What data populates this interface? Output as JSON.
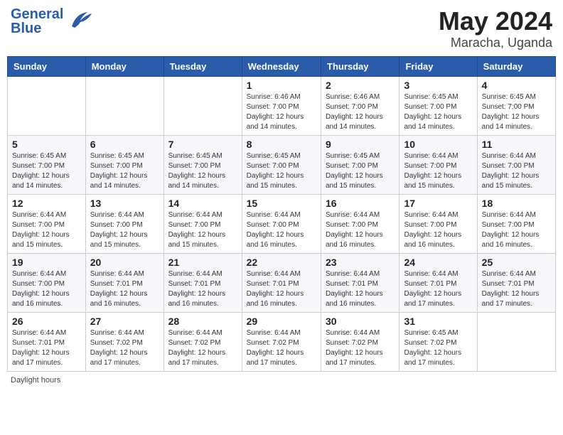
{
  "header": {
    "logo_general": "General",
    "logo_blue": "Blue",
    "month_year": "May 2024",
    "location": "Maracha, Uganda"
  },
  "footer": {
    "note": "Daylight hours"
  },
  "days_of_week": [
    "Sunday",
    "Monday",
    "Tuesday",
    "Wednesday",
    "Thursday",
    "Friday",
    "Saturday"
  ],
  "weeks": [
    [
      {
        "day": "",
        "info": ""
      },
      {
        "day": "",
        "info": ""
      },
      {
        "day": "",
        "info": ""
      },
      {
        "day": "1",
        "info": "Sunrise: 6:46 AM\nSunset: 7:00 PM\nDaylight: 12 hours and 14 minutes."
      },
      {
        "day": "2",
        "info": "Sunrise: 6:46 AM\nSunset: 7:00 PM\nDaylight: 12 hours and 14 minutes."
      },
      {
        "day": "3",
        "info": "Sunrise: 6:45 AM\nSunset: 7:00 PM\nDaylight: 12 hours and 14 minutes."
      },
      {
        "day": "4",
        "info": "Sunrise: 6:45 AM\nSunset: 7:00 PM\nDaylight: 12 hours and 14 minutes."
      }
    ],
    [
      {
        "day": "5",
        "info": "Sunrise: 6:45 AM\nSunset: 7:00 PM\nDaylight: 12 hours and 14 minutes."
      },
      {
        "day": "6",
        "info": "Sunrise: 6:45 AM\nSunset: 7:00 PM\nDaylight: 12 hours and 14 minutes."
      },
      {
        "day": "7",
        "info": "Sunrise: 6:45 AM\nSunset: 7:00 PM\nDaylight: 12 hours and 14 minutes."
      },
      {
        "day": "8",
        "info": "Sunrise: 6:45 AM\nSunset: 7:00 PM\nDaylight: 12 hours and 15 minutes."
      },
      {
        "day": "9",
        "info": "Sunrise: 6:45 AM\nSunset: 7:00 PM\nDaylight: 12 hours and 15 minutes."
      },
      {
        "day": "10",
        "info": "Sunrise: 6:44 AM\nSunset: 7:00 PM\nDaylight: 12 hours and 15 minutes."
      },
      {
        "day": "11",
        "info": "Sunrise: 6:44 AM\nSunset: 7:00 PM\nDaylight: 12 hours and 15 minutes."
      }
    ],
    [
      {
        "day": "12",
        "info": "Sunrise: 6:44 AM\nSunset: 7:00 PM\nDaylight: 12 hours and 15 minutes."
      },
      {
        "day": "13",
        "info": "Sunrise: 6:44 AM\nSunset: 7:00 PM\nDaylight: 12 hours and 15 minutes."
      },
      {
        "day": "14",
        "info": "Sunrise: 6:44 AM\nSunset: 7:00 PM\nDaylight: 12 hours and 15 minutes."
      },
      {
        "day": "15",
        "info": "Sunrise: 6:44 AM\nSunset: 7:00 PM\nDaylight: 12 hours and 16 minutes."
      },
      {
        "day": "16",
        "info": "Sunrise: 6:44 AM\nSunset: 7:00 PM\nDaylight: 12 hours and 16 minutes."
      },
      {
        "day": "17",
        "info": "Sunrise: 6:44 AM\nSunset: 7:00 PM\nDaylight: 12 hours and 16 minutes."
      },
      {
        "day": "18",
        "info": "Sunrise: 6:44 AM\nSunset: 7:00 PM\nDaylight: 12 hours and 16 minutes."
      }
    ],
    [
      {
        "day": "19",
        "info": "Sunrise: 6:44 AM\nSunset: 7:00 PM\nDaylight: 12 hours and 16 minutes."
      },
      {
        "day": "20",
        "info": "Sunrise: 6:44 AM\nSunset: 7:01 PM\nDaylight: 12 hours and 16 minutes."
      },
      {
        "day": "21",
        "info": "Sunrise: 6:44 AM\nSunset: 7:01 PM\nDaylight: 12 hours and 16 minutes."
      },
      {
        "day": "22",
        "info": "Sunrise: 6:44 AM\nSunset: 7:01 PM\nDaylight: 12 hours and 16 minutes."
      },
      {
        "day": "23",
        "info": "Sunrise: 6:44 AM\nSunset: 7:01 PM\nDaylight: 12 hours and 16 minutes."
      },
      {
        "day": "24",
        "info": "Sunrise: 6:44 AM\nSunset: 7:01 PM\nDaylight: 12 hours and 17 minutes."
      },
      {
        "day": "25",
        "info": "Sunrise: 6:44 AM\nSunset: 7:01 PM\nDaylight: 12 hours and 17 minutes."
      }
    ],
    [
      {
        "day": "26",
        "info": "Sunrise: 6:44 AM\nSunset: 7:01 PM\nDaylight: 12 hours and 17 minutes."
      },
      {
        "day": "27",
        "info": "Sunrise: 6:44 AM\nSunset: 7:02 PM\nDaylight: 12 hours and 17 minutes."
      },
      {
        "day": "28",
        "info": "Sunrise: 6:44 AM\nSunset: 7:02 PM\nDaylight: 12 hours and 17 minutes."
      },
      {
        "day": "29",
        "info": "Sunrise: 6:44 AM\nSunset: 7:02 PM\nDaylight: 12 hours and 17 minutes."
      },
      {
        "day": "30",
        "info": "Sunrise: 6:44 AM\nSunset: 7:02 PM\nDaylight: 12 hours and 17 minutes."
      },
      {
        "day": "31",
        "info": "Sunrise: 6:45 AM\nSunset: 7:02 PM\nDaylight: 12 hours and 17 minutes."
      },
      {
        "day": "",
        "info": ""
      }
    ]
  ]
}
